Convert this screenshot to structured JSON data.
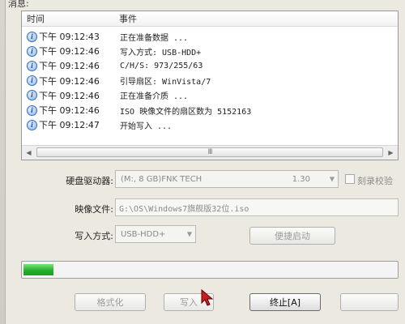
{
  "dialog": {
    "messages_label": "消息:"
  },
  "log": {
    "columns": {
      "time": "时间",
      "event": "事件"
    },
    "rows": [
      {
        "time": "下午 09:12:43",
        "event": "正在准备数据 ..."
      },
      {
        "time": "下午 09:12:46",
        "event": "写入方式: USB-HDD+"
      },
      {
        "time": "下午 09:12:46",
        "event": "C/H/S: 973/255/63"
      },
      {
        "time": "下午 09:12:46",
        "event": "引导扇区: WinVista/7"
      },
      {
        "time": "下午 09:12:46",
        "event": "正在准备介质 ..."
      },
      {
        "time": "下午 09:12:46",
        "event": "ISO 映像文件的扇区数为 5152163"
      },
      {
        "time": "下午 09:12:47",
        "event": "开始写入 ..."
      }
    ],
    "scroll_thumb_grip": "III"
  },
  "form": {
    "disk_label": "硬盘驱动器:",
    "disk_value": "(M:, 8 GB)FNK TECH",
    "disk_version": "1.30",
    "verify_label": "刻录校验",
    "image_label": "映像文件:",
    "image_value": "G:\\OS\\Windows7旗舰版32位.iso",
    "write_mode_label": "写入方式:",
    "write_mode_value": "USB-HDD+",
    "hide_boot_label": "便捷启动"
  },
  "progress": {
    "value_pct": 8
  },
  "buttons": {
    "format": "格式化",
    "write": "写入",
    "stop": "终止[A]"
  },
  "colors": {
    "progress_green": "#26b22a",
    "info_icon_blue": "#2f6fc3",
    "window_bg": "#ece9e0"
  }
}
